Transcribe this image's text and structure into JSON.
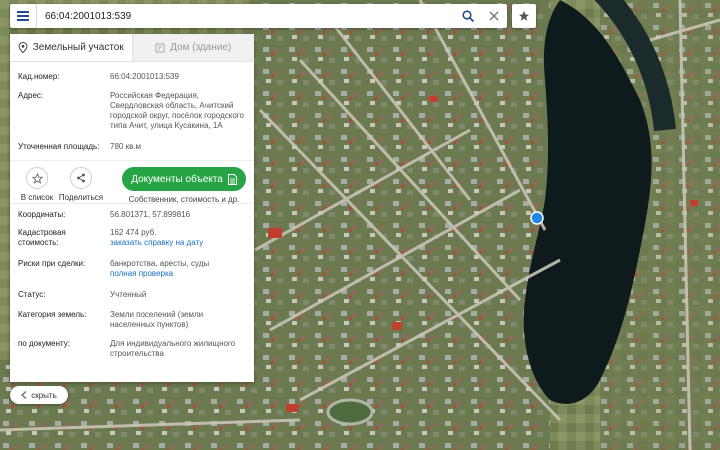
{
  "search": {
    "value": "66:04:2001013:539",
    "menu_icon": "hamburger-icon",
    "search_icon": "magnifier-icon",
    "clear_icon": "close-icon",
    "favorite_icon": "star-icon"
  },
  "tabs": [
    {
      "label": "Земельный участок",
      "icon": "land-plot-icon",
      "active": true
    },
    {
      "label": "Дом (здание)",
      "icon": "building-icon",
      "active": false
    }
  ],
  "info": {
    "cadnum_label": "Кад.номер:",
    "cadnum_value": "66:04:2001013:539",
    "address_label": "Адрес:",
    "address_value": "Российская Федерация, Свердловская область, Ачитский городской округ, посёлок городского типа Ачит, улица Кусакина, 1А",
    "area_label": "Уточненная площадь:",
    "area_value": "780 кв.м"
  },
  "actions": {
    "favorites_label": "В список",
    "share_label": "Поделиться",
    "docs_label": "Документы объекта",
    "docs_sub": "Собственник, стоимость и др."
  },
  "details": {
    "coords_label": "Координаты:",
    "coords_value": "56.801371, 57.899816",
    "cost_label_1": "Кадастровая",
    "cost_label_2": "стоимость:",
    "cost_value": "162 474 руб.",
    "cost_link": "заказать справку на дату",
    "risks_label": "Риски при сделки:",
    "risks_value": "банкротства, аресты, суды",
    "risks_link": "полная проверка",
    "status_label": "Статус:",
    "status_value": "Учтенный",
    "category_label": "Категория земель:",
    "category_value": "Земли поселений (земли населенных пунктов)",
    "usage_label": "по документу:",
    "usage_value": "Для индивидуального жилищного строительства"
  },
  "collapse": {
    "label": "скрыть",
    "icon": "chevron-left-icon"
  },
  "colors": {
    "accent": "#27a445",
    "link": "#1a6fc2",
    "menu": "#1e4f8a",
    "marker": "#1e88e5",
    "lake": "#0e1a1c"
  }
}
